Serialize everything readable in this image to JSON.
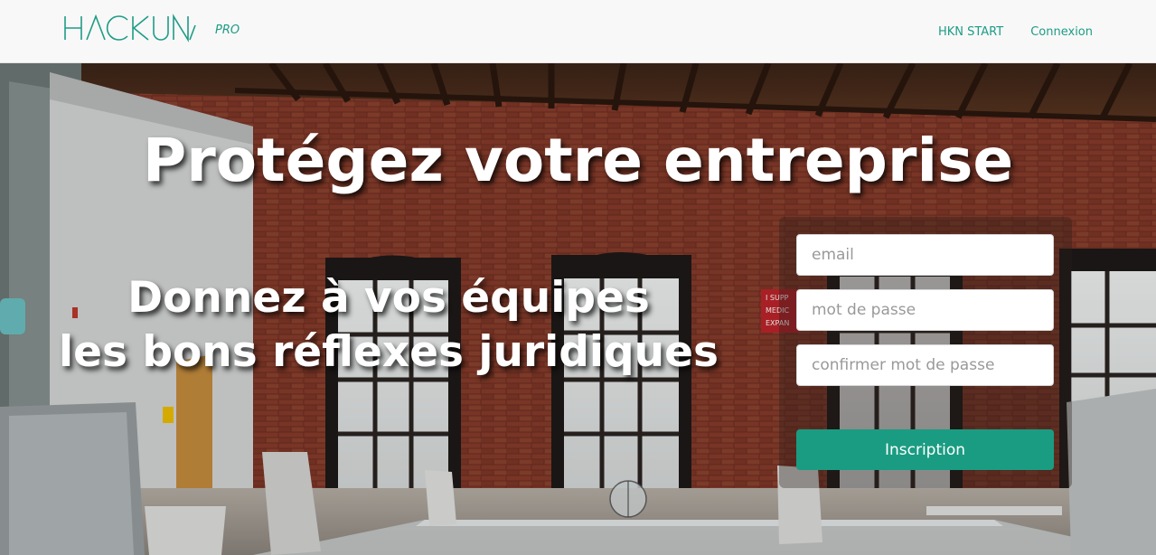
{
  "brand": {
    "name": "HACKUNA",
    "badge": "PRO"
  },
  "nav": {
    "links": [
      "HKN START",
      "Connexion"
    ]
  },
  "hero": {
    "headline": "Protégez votre entreprise",
    "tagline_line1": "Donnez à vos équipes",
    "tagline_line2": "les bons réflexes juridiques",
    "sign_text": "I SUPP MEDIC EXPAN"
  },
  "signup": {
    "email_placeholder": "email",
    "password_placeholder": "mot de passe",
    "confirm_placeholder": "confirmer mot de passe",
    "submit_label": "Inscription"
  },
  "colors": {
    "accent": "#1a9c82",
    "brand_text": "#1e9c86",
    "nav_bg": "#f8f8f8"
  }
}
